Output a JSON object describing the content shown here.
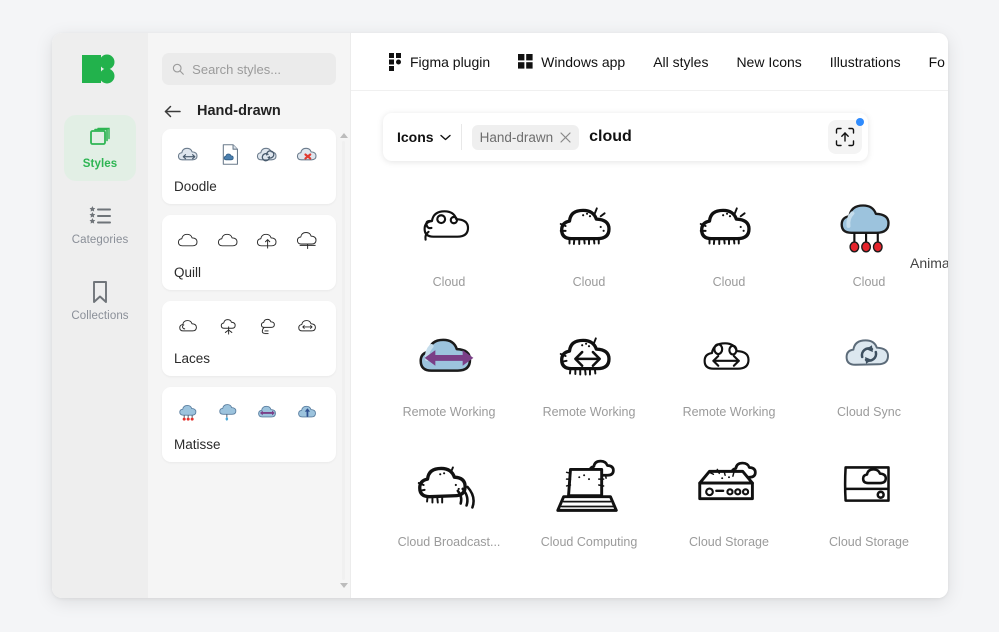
{
  "rail": {
    "logo_name": "icons8-logo",
    "brand_color": "#22b24c",
    "items": [
      {
        "label": "Styles",
        "icon": "layers-icon",
        "active": true
      },
      {
        "label": "Categories",
        "icon": "list-icon",
        "active": false
      },
      {
        "label": "Collections",
        "icon": "bookmark-icon",
        "active": false
      }
    ]
  },
  "style_list": {
    "search": {
      "placeholder": "Search styles...",
      "value": ""
    },
    "back_icon": "arrow-left-icon",
    "title": "Hand-drawn",
    "cards": [
      {
        "name": "Doodle"
      },
      {
        "name": "Quill"
      },
      {
        "name": "Laces"
      },
      {
        "name": "Matisse"
      }
    ]
  },
  "topnav": {
    "items": [
      {
        "label": "Figma plugin",
        "icon": "figma-icon"
      },
      {
        "label": "Windows app",
        "icon": "windows-icon"
      },
      {
        "label": "All styles",
        "icon": ""
      },
      {
        "label": "New Icons",
        "icon": ""
      },
      {
        "label": "Illustrations",
        "icon": ""
      },
      {
        "label": "Fo",
        "icon": ""
      }
    ]
  },
  "searchbar": {
    "type_label": "Icons",
    "type_chevron": "chevron-down-icon",
    "filter_chip": {
      "label": "Hand-drawn",
      "remove_icon": "close-icon"
    },
    "query": "cloud",
    "upload_icon": "upload-image-icon",
    "has_notification_dot": true,
    "notification_color": "#2f8bfd",
    "animated_toggle_label": "Animated"
  },
  "results": {
    "icons": [
      {
        "label": "Cloud",
        "art": "cloud-outline"
      },
      {
        "label": "Cloud",
        "art": "cloud-sketch"
      },
      {
        "label": "Cloud",
        "art": "cloud-sketch"
      },
      {
        "label": "Cloud",
        "art": "cloud-rain-color"
      },
      {
        "label": "Remote Working",
        "art": "cloud-arrows-color"
      },
      {
        "label": "Remote Working",
        "art": "cloud-arrows-sketch"
      },
      {
        "label": "Remote Working",
        "art": "cloud-arrows-line"
      },
      {
        "label": "Cloud Sync",
        "art": "cloud-sync-color"
      },
      {
        "label": "Cloud Broadcast...",
        "art": "cloud-broadcast"
      },
      {
        "label": "Cloud Computing",
        "art": "cloud-laptop"
      },
      {
        "label": "Cloud Storage",
        "art": "cloud-server"
      },
      {
        "label": "Cloud Storage",
        "art": "cloud-drive-line"
      }
    ]
  }
}
